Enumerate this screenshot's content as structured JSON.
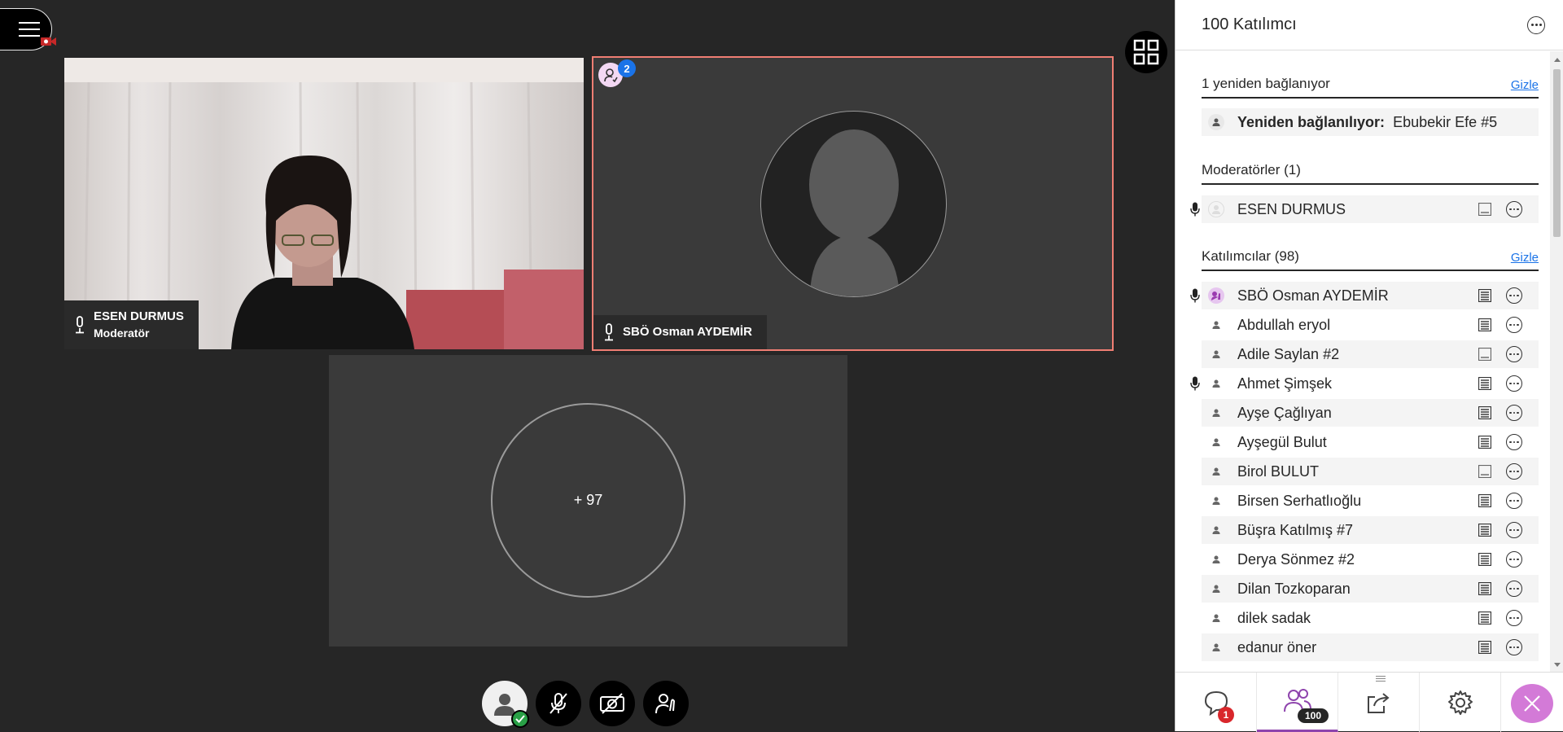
{
  "stage": {
    "tiles": [
      {
        "name": "ESEN DURMUS",
        "role": "Moderatör"
      },
      {
        "name": "SBÖ Osman AYDEMİR",
        "badge_count": "2"
      },
      {
        "more_label": "+ 97"
      }
    ]
  },
  "panel": {
    "title": "100 Katılımcı",
    "reconnecting": {
      "heading": "1 yeniden bağlanıyor",
      "hide_label": "Gizle",
      "prefix": "Yeniden bağlanılıyor:",
      "name": "Ebubekir Efe #5"
    },
    "moderators": {
      "heading": "Moderatörler (1)",
      "items": [
        {
          "name": "ESEN DURMUS",
          "mic": true
        }
      ]
    },
    "participants": {
      "heading": "Katılımcılar (98)",
      "hide_label": "Gizle",
      "items": [
        {
          "name": "SBÖ Osman AYDEMİR",
          "mic": true
        },
        {
          "name": "Abdullah eryol"
        },
        {
          "name": "Adile Saylan #2"
        },
        {
          "name": "Ahmet Şimşek",
          "mic": true
        },
        {
          "name": "Ayşe Çağlıyan"
        },
        {
          "name": "Ayşegül Bulut"
        },
        {
          "name": "Birol BULUT"
        },
        {
          "name": "Birsen Serhatlıoğlu"
        },
        {
          "name": "Büşra Katılmış #7"
        },
        {
          "name": "Derya Sönmez #2"
        },
        {
          "name": "Dilan Tozkoparan"
        },
        {
          "name": "dilek sadak"
        },
        {
          "name": "edanur öner"
        }
      ]
    },
    "footer": {
      "chat_badge": "1",
      "participants_badge": "100"
    }
  },
  "colors": {
    "accent": "#8e44ad",
    "active_border": "#f07e73",
    "badge_blue": "#1a73e8",
    "badge_red": "#d9262b",
    "close_bg": "#d37ad7"
  }
}
